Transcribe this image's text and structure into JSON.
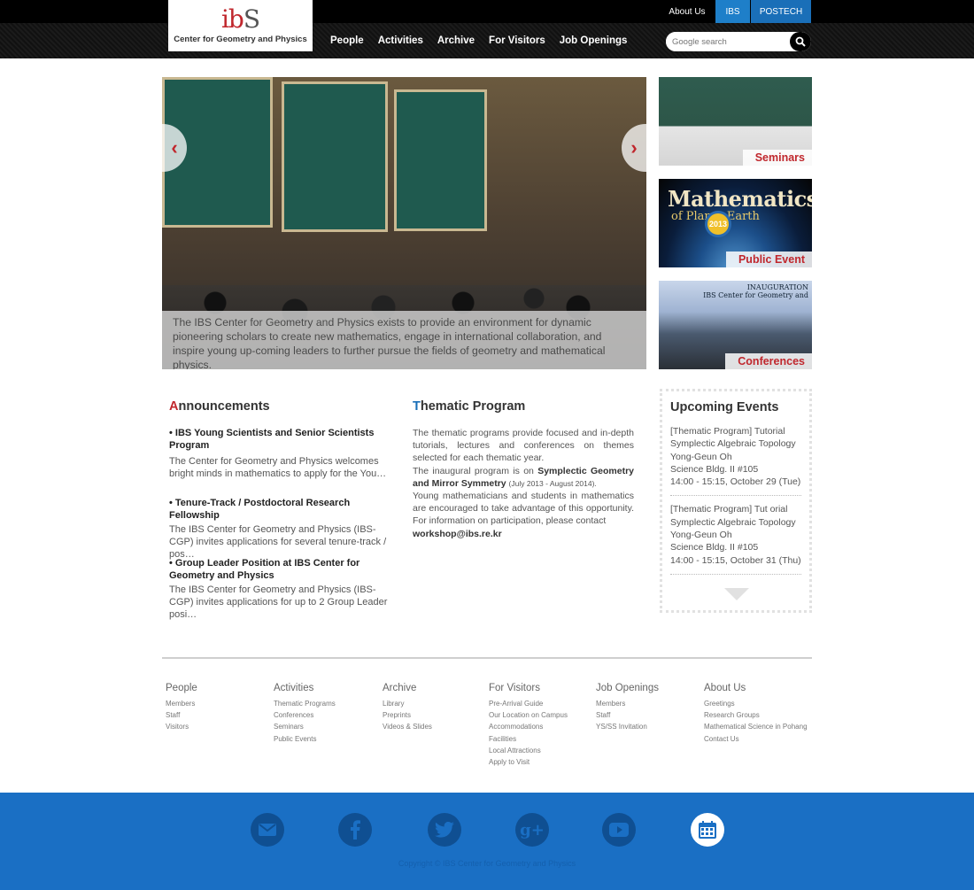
{
  "header": {
    "logo_mark_1": "ib",
    "logo_mark_2": "S",
    "logo_subtitle": "Center for Geometry and Physics",
    "util_links": [
      "About Us",
      "IBS",
      "POSTECH"
    ],
    "nav": [
      "People",
      "Activities",
      "Archive",
      "For Visitors",
      "Job Openings"
    ],
    "search_placeholder": "Google search"
  },
  "hero": {
    "caption": "The IBS Center for Geometry and Physics exists to provide an environment for dynamic pioneering scholars to create new mathematics, engage in international collaboration, and inspire young up-coming leaders to further pursue the fields of geometry and mathematical physics.",
    "prev_arrow": "‹",
    "next_arrow": "›"
  },
  "side_thumbs": [
    {
      "label": "Seminars"
    },
    {
      "label": "Public Event",
      "title": "Mathematics",
      "sub": "of Planet Earth",
      "year": "2013"
    },
    {
      "label": "Conferences",
      "banner": "INAUGURATION\nIBS Center for Geometry and"
    }
  ],
  "announcements": {
    "title_first": "A",
    "title_rest": "nnouncements",
    "items": [
      {
        "head": "• IBS Young Scientists and Senior Scientists Program",
        "body": "The Center for Geometry and Physics welcomes bright minds in mathematics to apply for the You…"
      },
      {
        "head": "• Tenure-Track / Postdoctoral Research Fellowship",
        "body": "The IBS Center for Geometry and Physics (IBS-CGP) invites applications for several tenure-track / pos…"
      },
      {
        "head": "• Group Leader Position at IBS Center for Geometry and Physics",
        "body": "The IBS Center for Geometry and Physics (IBS-CGP) invites applications for up to 2 Group Leader posi…"
      }
    ]
  },
  "thematic": {
    "title_first": "T",
    "title_rest": "hematic Program",
    "p1": "The thematic programs provide focused and in-depth tutorials, lectures and conferences on themes selected for each thematic year.",
    "p2_pre": "The inaugural program is on ",
    "p2_bold": "Symplectic Geometry and Mirror Symmetry",
    "p2_small": "(July 2013 - August 2014).",
    "p3": "Young mathematicians and students in mathematics are encouraged to take advantage of this opportunity. For information on participation, please contact",
    "email": "workshop@ibs.re.kr"
  },
  "events": {
    "title": "Upcoming Events",
    "items": [
      {
        "l1": "[Thematic Program] Tutorial",
        "l2": "Symplectic Algebraic Topology",
        "l3": "Yong-Geun Oh",
        "l4": "Science Bldg. II #105",
        "l5": "14:00 - 15:15, October 29 (Tue)"
      },
      {
        "l1": "[Thematic Program] Tut  orial",
        "l2": "Symplectic Algebraic Topology",
        "l3": "Yong-Geun Oh",
        "l4": "Science Bldg. II #105",
        "l5": "14:00 - 15:15, October 31 (Thu)"
      }
    ]
  },
  "sitemap": [
    {
      "head": "People",
      "links": [
        "Members",
        "Staff",
        "Visitors"
      ]
    },
    {
      "head": "Activities",
      "links": [
        "Thematic Programs",
        "Conferences",
        "Seminars",
        "Public Events"
      ]
    },
    {
      "head": "Archive",
      "links": [
        "Library",
        "Preprints",
        "Videos & Slides"
      ]
    },
    {
      "head": "For Visitors",
      "links": [
        "Pre-Arrival Guide",
        "Our Location on Campus",
        "Accommodations",
        "Facilities",
        "Local Attractions",
        "Apply to Visit"
      ]
    },
    {
      "head": "Job Openings",
      "links": [
        "Members",
        "Staff",
        "YS/SS Invitation"
      ]
    },
    {
      "head": "About Us",
      "links": [
        "Greetings",
        "Research Groups",
        "Mathematical Science in Pohang",
        "Contact Us"
      ]
    }
  ],
  "footer": {
    "social": [
      "mail-icon",
      "facebook-icon",
      "twitter-icon",
      "google-plus-icon",
      "youtube-icon",
      "calendar-icon"
    ],
    "copyright": "Copyright © IBS Center for Geometry and Physics"
  },
  "colors": {
    "accent_red": "#c0272d",
    "blue": "#1a6fc4"
  }
}
